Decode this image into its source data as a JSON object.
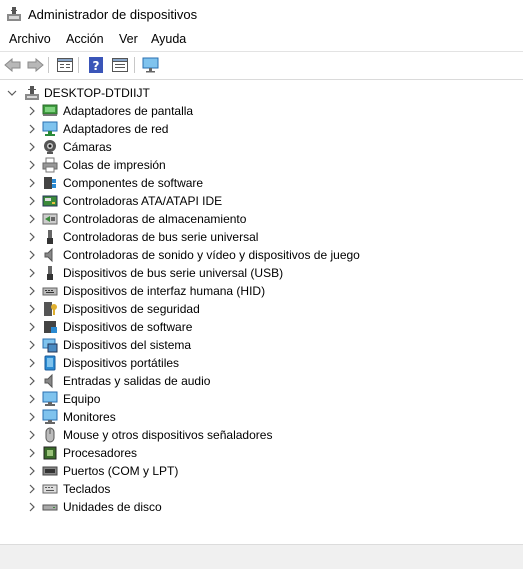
{
  "window": {
    "title": "Administrador de dispositivos"
  },
  "menu": {
    "items": [
      {
        "label": "Archivo"
      },
      {
        "label": "Acción"
      },
      {
        "label": "Ver"
      },
      {
        "label": "Ayuda"
      }
    ]
  },
  "toolbar": {
    "buttons": [
      "back-icon",
      "forward-icon",
      "properties-icon",
      "help-icon",
      "show-hide-icon",
      "scan-hardware-icon"
    ]
  },
  "tree": {
    "root": {
      "label": "DESKTOP-DTDIIJT",
      "icon": "computer-icon"
    },
    "items": [
      {
        "label": "Adaptadores de pantalla",
        "icon": "display-adapter-icon"
      },
      {
        "label": "Adaptadores de red",
        "icon": "network-adapter-icon"
      },
      {
        "label": "Cámaras",
        "icon": "camera-icon"
      },
      {
        "label": "Colas de impresión",
        "icon": "printer-icon"
      },
      {
        "label": "Componentes de software",
        "icon": "software-component-icon"
      },
      {
        "label": "Controladoras ATA/ATAPI IDE",
        "icon": "ide-controller-icon"
      },
      {
        "label": "Controladoras de almacenamiento",
        "icon": "storage-controller-icon"
      },
      {
        "label": "Controladoras de bus serie universal",
        "icon": "usb-controller-icon"
      },
      {
        "label": "Controladoras de sonido y vídeo y dispositivos de juego",
        "icon": "sound-icon"
      },
      {
        "label": "Dispositivos de bus serie universal (USB)",
        "icon": "usb-device-icon"
      },
      {
        "label": "Dispositivos de interfaz humana (HID)",
        "icon": "hid-icon"
      },
      {
        "label": "Dispositivos de seguridad",
        "icon": "security-device-icon"
      },
      {
        "label": "Dispositivos de software",
        "icon": "software-device-icon"
      },
      {
        "label": "Dispositivos del sistema",
        "icon": "system-device-icon"
      },
      {
        "label": "Dispositivos portátiles",
        "icon": "portable-device-icon"
      },
      {
        "label": "Entradas y salidas de audio",
        "icon": "audio-io-icon"
      },
      {
        "label": "Equipo",
        "icon": "computer-icon"
      },
      {
        "label": "Monitores",
        "icon": "monitor-icon"
      },
      {
        "label": "Mouse y otros dispositivos señaladores",
        "icon": "mouse-icon"
      },
      {
        "label": "Procesadores",
        "icon": "processor-icon"
      },
      {
        "label": "Puertos (COM y LPT)",
        "icon": "port-icon"
      },
      {
        "label": "Teclados",
        "icon": "keyboard-icon"
      },
      {
        "label": "Unidades de disco",
        "icon": "disk-drive-icon"
      }
    ]
  },
  "colors": {
    "accent": "#1e88d2",
    "chevron": "#5a5a5a",
    "statusbar": "#f0f0f0"
  }
}
